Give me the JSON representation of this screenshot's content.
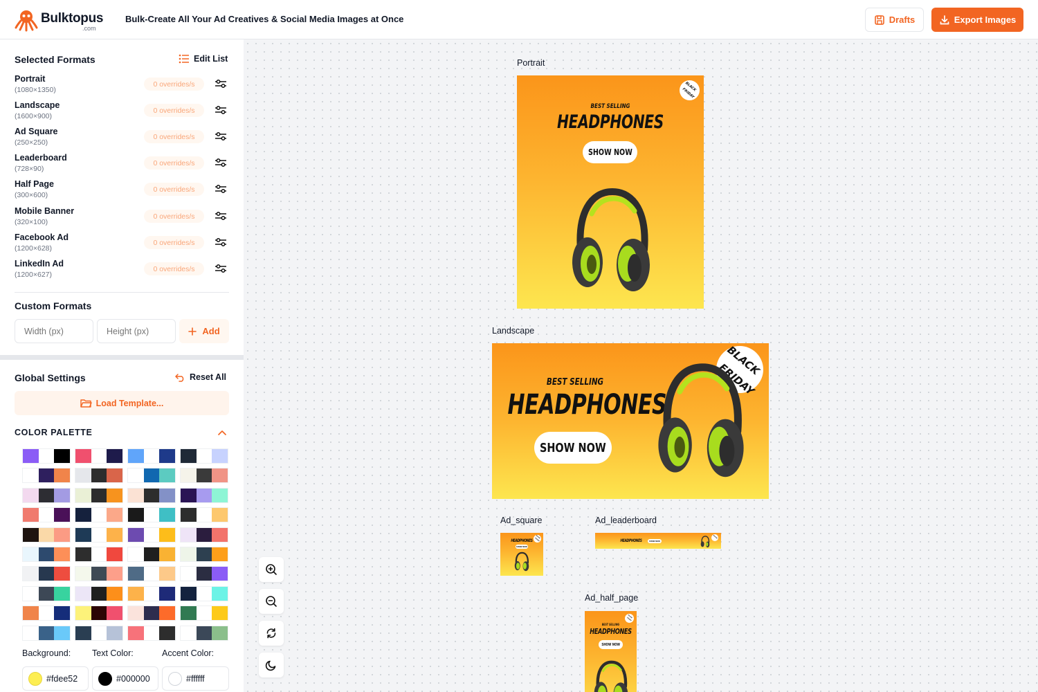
{
  "header": {
    "logo_name": "Bulktopus",
    "logo_sub": ".com",
    "tagline": "Bulk-Create All Your Ad Creatives & Social Media Images at Once",
    "drafts_label": "Drafts",
    "export_label": "Export Images",
    "accent": "#f26522"
  },
  "sidebar": {
    "selected_title": "Selected Formats",
    "edit_list": "Edit List",
    "formats": [
      {
        "name": "Portrait",
        "dim": "(1080×1350)",
        "badge": "0 overrides/s"
      },
      {
        "name": "Landscape",
        "dim": "(1600×900)",
        "badge": "0 overrides/s"
      },
      {
        "name": "Ad Square",
        "dim": "(250×250)",
        "badge": "0 overrides/s"
      },
      {
        "name": "Leaderboard",
        "dim": "(728×90)",
        "badge": "0 overrides/s"
      },
      {
        "name": "Half Page",
        "dim": "(300×600)",
        "badge": "0 overrides/s"
      },
      {
        "name": "Mobile Banner",
        "dim": "(320×100)",
        "badge": "0 overrides/s"
      },
      {
        "name": "Facebook Ad",
        "dim": "(1200×628)",
        "badge": "0 overrides/s"
      },
      {
        "name": "LinkedIn Ad",
        "dim": "(1200×627)",
        "badge": "0 overrides/s"
      }
    ],
    "custom_title": "Custom Formats",
    "width_placeholder": "Width (px)",
    "height_placeholder": "Height (px)",
    "add_label": "Add",
    "global_title": "Global Settings",
    "reset_all": "Reset All",
    "load_template": "Load Template...",
    "palette_title": "COLOR PALETTE",
    "palettes": [
      [
        "#8b5cf6",
        "#ffffff",
        "#000000"
      ],
      [
        "#f0506e",
        "#ffffff",
        "#1e1b4b"
      ],
      [
        "#60a5fa",
        "#ffffff",
        "#1e3a8a"
      ],
      [
        "#1f2937",
        "#ffffff",
        "#c7d2fe"
      ],
      [
        "#ffffff",
        "#2e1f5e",
        "#f0844a"
      ],
      [
        "#e5e7eb",
        "#2d2d2d",
        "#d9654a"
      ],
      [
        "#ffffff",
        "#1168b0",
        "#5ccbc1"
      ],
      [
        "#f5f3ea",
        "#3a3a3a",
        "#f09486"
      ],
      [
        "#f3d9ef",
        "#2d2d33",
        "#a39be3"
      ],
      [
        "#eaf0d6",
        "#2d2d2d",
        "#f7931e"
      ],
      [
        "#fbe2d4",
        "#2d2d2d",
        "#8391c7"
      ],
      [
        "#2a1455",
        "#a79bef",
        "#8ef5d5"
      ],
      [
        "#f07a6e",
        "#ffffff",
        "#4a1158"
      ],
      [
        "#15213d",
        "#ffffff",
        "#fba889"
      ],
      [
        "#1a1a1a",
        "#ffffff",
        "#3fbfc5"
      ],
      [
        "#2d2d2d",
        "#ffffff",
        "#fdc86e"
      ],
      [
        "#1e1410",
        "#fad9a8",
        "#fb9b84"
      ],
      [
        "#1e3a56",
        "#ffffff",
        "#fdb24a"
      ],
      [
        "#6d4bb0",
        "#ffffff",
        "#fdbd1a"
      ],
      [
        "#efe4f7",
        "#2b1d3e",
        "#f2736b"
      ],
      [
        "#e9f6fd",
        "#2d4a6e",
        "#fd8f58"
      ],
      [
        "#2d2d2d",
        "#ffffff",
        "#f0483e"
      ],
      [
        "#ffffff",
        "#1f1f1f",
        "#f9b233"
      ],
      [
        "#eef5e9",
        "#2d4050",
        "#fd9f1a"
      ],
      [
        "#f1f2f4",
        "#27384f",
        "#ee4d3f"
      ],
      [
        "#f4f8ec",
        "#3f4a55",
        "#fd9f8a"
      ],
      [
        "#4f6b86",
        "#ffffff",
        "#fdc989"
      ],
      [
        "#ffffff",
        "#2b2d42",
        "#8b5cf6"
      ],
      [
        "#ffffff",
        "#3d4856",
        "#38d39f"
      ],
      [
        "#ece6f7",
        "#1f1f1f",
        "#fd8f1a"
      ],
      [
        "#fdb24a",
        "#ffffff",
        "#1e2a78"
      ],
      [
        "#13223e",
        "#ffffff",
        "#6cf3e6"
      ],
      [
        "#f0844a",
        "#ffffff",
        "#152d7a"
      ],
      [
        "#fdf27a",
        "#2b0505",
        "#f0506e"
      ],
      [
        "#fbe3dc",
        "#2d2d4e",
        "#fd6b2a"
      ],
      [
        "#317a52",
        "#ffffff",
        "#fdca1a"
      ],
      [
        "#ffffff",
        "#3a6289",
        "#6ac9f9"
      ],
      [
        "#2a3e52",
        "#ffffff",
        "#b6c2d8"
      ],
      [
        "#f7727a",
        "#ffffff",
        "#2d2d2d"
      ],
      [
        "#ffffff",
        "#3b4858",
        "#8bbf8b"
      ]
    ],
    "bg_label": "Background:",
    "text_label": "Text Color:",
    "accent_label": "Accent Color:",
    "bg_value": "#fdee52",
    "text_value": "#000000",
    "accent_value": "#ffffff"
  },
  "canvas": {
    "portrait": {
      "label": "Portrait"
    },
    "landscape": {
      "label": "Landscape"
    },
    "square": {
      "label": "Ad_square"
    },
    "leaderboard": {
      "label": "Ad_leaderboard"
    },
    "halfpage": {
      "label": "Ad_half_page"
    },
    "ad_text": {
      "best": "BEST SELLING",
      "head": "HEADPHONES",
      "shop": "SHOW NOW",
      "bf1": "BLACK",
      "bf2": "FRIDAY"
    }
  }
}
